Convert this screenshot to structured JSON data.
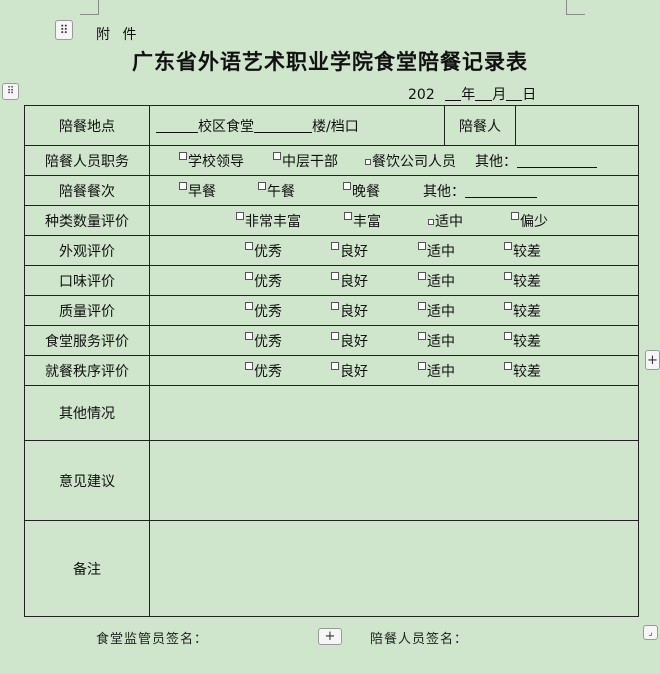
{
  "header": {
    "attachment_label": "附 件",
    "title": "广东省外语艺术职业学院食堂陪餐记录表",
    "date": {
      "year_prefix": "202",
      "year": "年",
      "month": "月",
      "day": "日"
    }
  },
  "table": {
    "location": {
      "label": "陪餐地点",
      "campus_suffix": "校区食堂",
      "building_suffix": "楼/档口",
      "companion_label": "陪餐人"
    },
    "position": {
      "label": "陪餐人员职务",
      "options": [
        "学校领导",
        "中层干部",
        "餐饮公司人员"
      ],
      "other": "其他："
    },
    "meal": {
      "label": "陪餐餐次",
      "options": [
        "早餐",
        "午餐",
        "晚餐"
      ],
      "other": "其他："
    },
    "variety": {
      "label": "种类数量评价",
      "options": [
        "非常丰富",
        "丰富",
        "适中",
        "偏少"
      ]
    },
    "ratings": [
      {
        "label": "外观评价",
        "options": [
          "优秀",
          "良好",
          "适中",
          "较差"
        ]
      },
      {
        "label": "口味评价",
        "options": [
          "优秀",
          "良好",
          "适中",
          "较差"
        ]
      },
      {
        "label": "质量评价",
        "options": [
          "优秀",
          "良好",
          "适中",
          "较差"
        ]
      },
      {
        "label": "食堂服务评价",
        "options": [
          "优秀",
          "良好",
          "适中",
          "较差"
        ]
      },
      {
        "label": "就餐秩序评价",
        "options": [
          "优秀",
          "良好",
          "适中",
          "较差"
        ]
      }
    ],
    "other_situation": {
      "label": "其他情况"
    },
    "suggestions": {
      "label": "意见建议"
    },
    "remarks": {
      "label": "备注"
    }
  },
  "footer": {
    "supervisor_sign": "食堂监管员签名：",
    "companion_sign": "陪餐人员签名："
  },
  "controls": {
    "move_icon": "drag-handle-icon",
    "add_icon": "plus-icon",
    "resize_icon": "resize-icon"
  }
}
